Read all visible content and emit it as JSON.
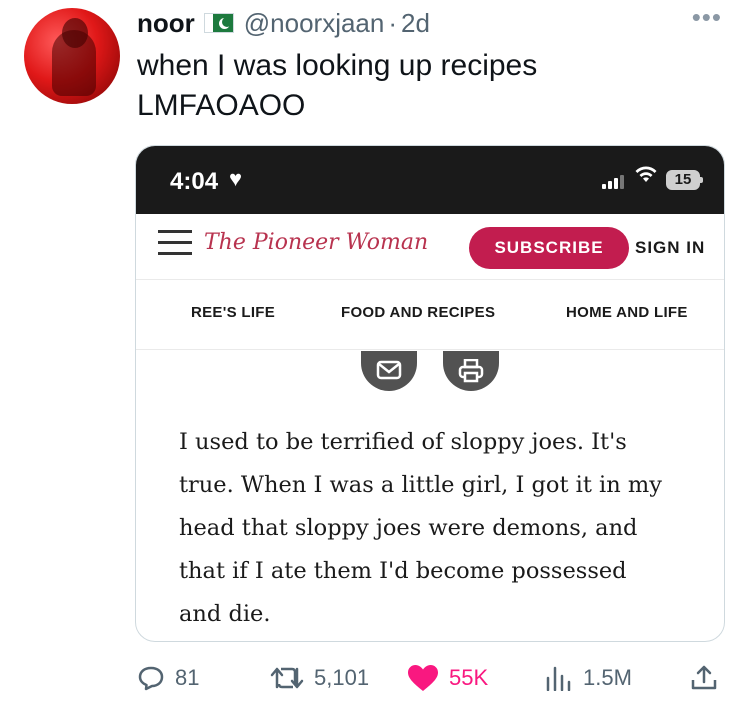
{
  "tweet": {
    "author_name": "noor",
    "flag_icon": "pakistan-flag-icon",
    "handle": "@noorxjaan",
    "separator": "·",
    "timestamp": "2d",
    "more_icon": "more-options-icon",
    "text_line_1": "when I was looking up recipes",
    "text_line_2": "LMFAOAOO"
  },
  "screenshot": {
    "statusbar": {
      "time": "4:04",
      "heart": "♥",
      "battery": "15"
    },
    "site": {
      "logo_text": "The Pioneer Woman",
      "subscribe_label": "SUBSCRIBE",
      "signin_label": "SIGN IN",
      "nav": [
        {
          "label": "REE'S LIFE"
        },
        {
          "label": "FOOD AND RECIPES"
        },
        {
          "label": "HOME AND LIFE"
        }
      ]
    },
    "article_lines": [
      "I used to be terrified of sloppy joes. It's",
      "true. When I was a little girl, I got it in my",
      "head that sloppy joes were demons, and",
      "that if I ate them I'd become possessed",
      "and die."
    ]
  },
  "actions": {
    "replies": "81",
    "reposts": "5,101",
    "likes": "55K",
    "views": "1.5M"
  },
  "colors": {
    "accent_subscribe": "#c21d4f",
    "like_pink": "#f91880",
    "muted": "#536471"
  }
}
